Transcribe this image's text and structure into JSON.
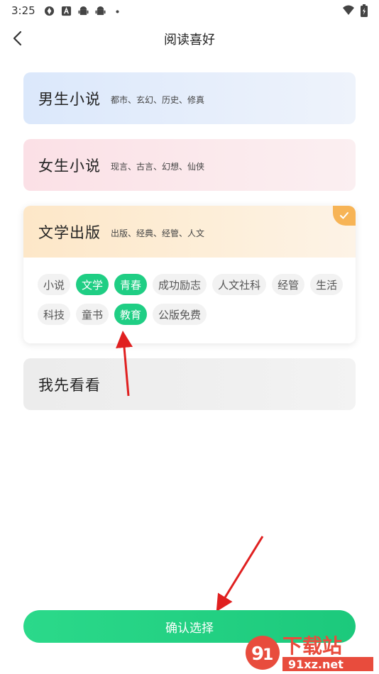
{
  "status_bar": {
    "time": "3:25",
    "icons": [
      "settings-sync-icon",
      "a-box-icon",
      "android-icon",
      "android-icon",
      "dot-icon"
    ],
    "right_icons": [
      "wifi-icon",
      "battery-icon"
    ]
  },
  "header": {
    "title": "阅读喜好"
  },
  "cards": {
    "male": {
      "title": "男生小说",
      "subtitle": "都市、玄幻、历史、修真"
    },
    "female": {
      "title": "女生小说",
      "subtitle": "现言、古言、幻想、仙侠"
    },
    "literature": {
      "title": "文学出版",
      "subtitle": "出版、经典、经管、人文",
      "selected": true,
      "tags_row1": [
        {
          "label": "小说",
          "selected": false
        },
        {
          "label": "文学",
          "selected": true
        },
        {
          "label": "青春",
          "selected": true
        },
        {
          "label": "成功励志",
          "selected": false
        },
        {
          "label": "人文社科",
          "selected": false
        },
        {
          "label": "经管",
          "selected": false
        },
        {
          "label": "生活",
          "selected": false
        }
      ],
      "tags_row2": [
        {
          "label": "科技",
          "selected": false
        },
        {
          "label": "童书",
          "selected": false
        },
        {
          "label": "教育",
          "selected": true
        },
        {
          "label": "公版免费",
          "selected": false
        }
      ]
    },
    "skip": {
      "title": "我先看看"
    }
  },
  "confirm_label": "确认选择",
  "watermark": {
    "line1": "下载站",
    "line2": "91xz.net"
  },
  "colors": {
    "accent": "#1fce84",
    "check": "#f7b456",
    "arrow": "#e02020"
  }
}
